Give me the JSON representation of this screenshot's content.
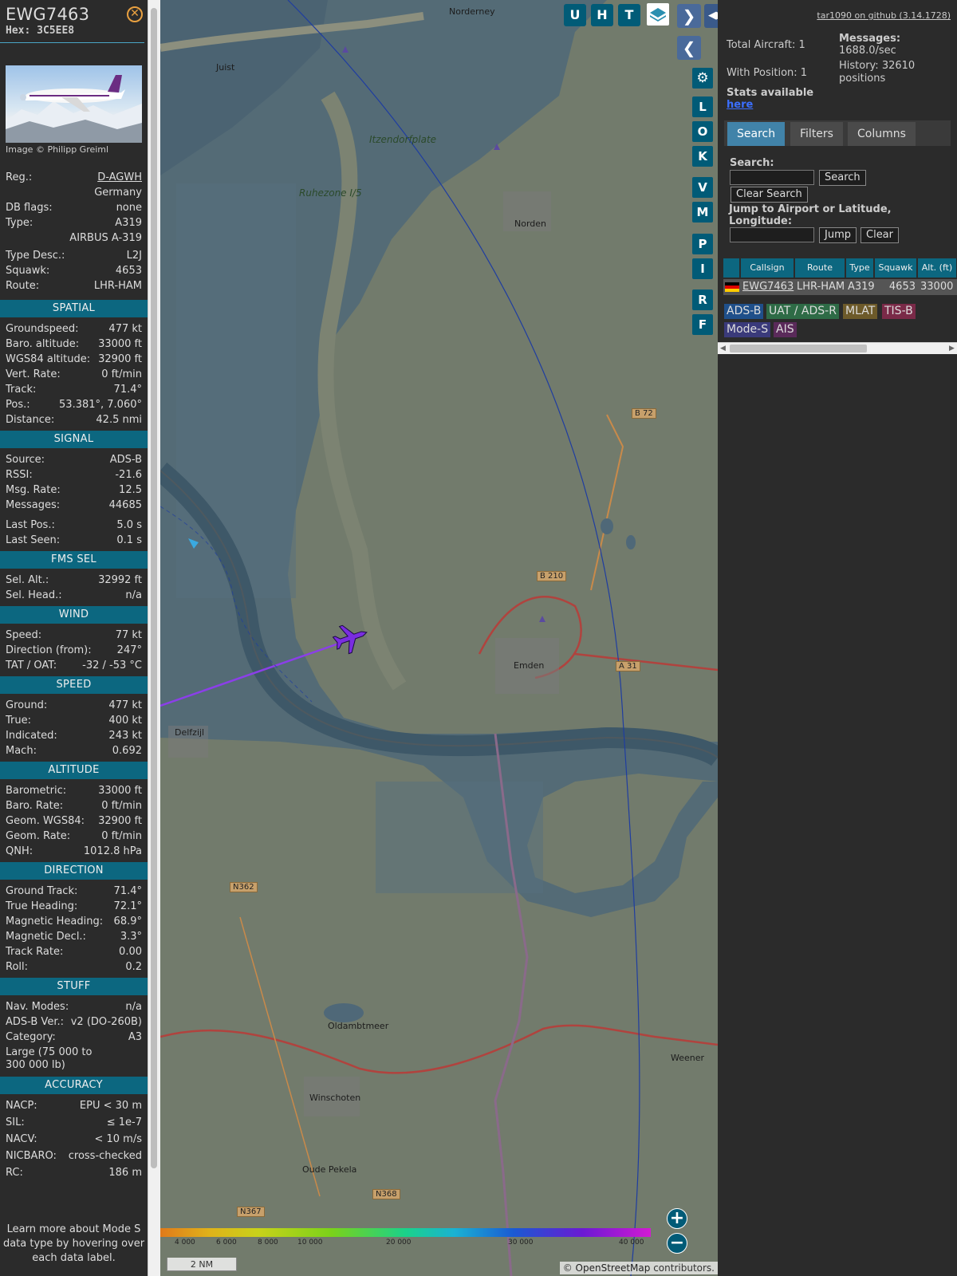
{
  "aircraft": {
    "callsign": "EWG7463",
    "hex": "Hex: 3C5EE8",
    "photo_credit": "Image © Philipp Greiml"
  },
  "info_rows": [
    {
      "k": "Reg.:",
      "v": "D-AGWH"
    },
    {
      "k": "",
      "v": "Germany"
    },
    {
      "k": "DB flags:",
      "v": "none"
    },
    {
      "k": "Type:",
      "v": "A319"
    },
    {
      "k": "",
      "v": "AIRBUS A-319"
    },
    {
      "k": "Type Desc.:",
      "v": "L2J"
    },
    {
      "k": "Squawk:",
      "v": "4653"
    },
    {
      "k": "Route:",
      "v": "LHR-HAM"
    }
  ],
  "sections": [
    {
      "title": "SPATIAL",
      "rows": [
        {
          "k": "Groundspeed:",
          "v": "477 kt"
        },
        {
          "k": "Baro. altitude:",
          "v": "33000 ft"
        },
        {
          "k": "WGS84 altitude:",
          "v": "32900 ft"
        },
        {
          "k": "Vert. Rate:",
          "v": "0 ft/min"
        },
        {
          "k": "Track:",
          "v": "71.4°"
        },
        {
          "k": "Pos.:",
          "v": "53.381°, 7.060°"
        },
        {
          "k": "Distance:",
          "v": "42.5 nmi"
        }
      ]
    },
    {
      "title": "SIGNAL",
      "rows": [
        {
          "k": "Source:",
          "v": "ADS-B"
        },
        {
          "k": "RSSI:",
          "v": "-21.6"
        },
        {
          "k": "Msg. Rate:",
          "v": "12.5"
        },
        {
          "k": "Messages:",
          "v": "44685"
        },
        {
          "k": "Last Pos.:",
          "v": "5.0 s"
        },
        {
          "k": "Last Seen:",
          "v": "0.1 s"
        }
      ]
    },
    {
      "title": "FMS SEL",
      "rows": [
        {
          "k": "Sel. Alt.:",
          "v": "32992 ft"
        },
        {
          "k": "Sel. Head.:",
          "v": "n/a"
        }
      ]
    },
    {
      "title": "WIND",
      "rows": [
        {
          "k": "Speed:",
          "v": "77 kt"
        },
        {
          "k": "Direction (from):",
          "v": "247°"
        },
        {
          "k": "TAT / OAT:",
          "v": "-32 / -53 °C"
        }
      ]
    },
    {
      "title": "SPEED",
      "rows": [
        {
          "k": "Ground:",
          "v": "477 kt"
        },
        {
          "k": "True:",
          "v": "400 kt"
        },
        {
          "k": "Indicated:",
          "v": "243 kt"
        },
        {
          "k": "Mach:",
          "v": "0.692"
        }
      ]
    },
    {
      "title": "ALTITUDE",
      "rows": [
        {
          "k": "Barometric:",
          "v": "33000 ft"
        },
        {
          "k": "Baro. Rate:",
          "v": "0 ft/min"
        },
        {
          "k": "Geom. WGS84:",
          "v": "32900 ft"
        },
        {
          "k": "Geom. Rate:",
          "v": "0 ft/min"
        },
        {
          "k": "QNH:",
          "v": "1012.8 hPa"
        }
      ]
    },
    {
      "title": "DIRECTION",
      "rows": [
        {
          "k": "Ground Track:",
          "v": "71.4°"
        },
        {
          "k": "True Heading:",
          "v": "72.1°"
        },
        {
          "k": "Magnetic Heading:",
          "v": "68.9°"
        },
        {
          "k": "Magnetic Decl.:",
          "v": "3.3°"
        },
        {
          "k": "Track Rate:",
          "v": "0.00"
        },
        {
          "k": "Roll:",
          "v": "0.2"
        }
      ]
    },
    {
      "title": "STUFF",
      "rows": [
        {
          "k": "Nav. Modes:",
          "v": "n/a"
        },
        {
          "k": "ADS-B Ver.:",
          "v": "v2 (DO-260B)"
        },
        {
          "k": "Category:",
          "v": "A3"
        },
        {
          "k": "Large (75 000 to 300 000 lb)",
          "v": ""
        }
      ]
    },
    {
      "title": "ACCURACY",
      "rows": [
        {
          "k": "NACP:",
          "v": "EPU < 30 m"
        },
        {
          "k": "SIL:",
          "v": "≤ 1e-7"
        },
        {
          "k": "NACV:",
          "v": "< 10 m/s"
        },
        {
          "k": "NICBARO:",
          "v": "cross-checked"
        },
        {
          "k": "RC:",
          "v": "186 m"
        }
      ]
    }
  ],
  "learn_more": "Learn more about Mode S data type by hovering over each data label.",
  "map": {
    "top_buttons": [
      "U",
      "H",
      "T"
    ],
    "side_buttons": [
      "L",
      "O",
      "K",
      "V",
      "M",
      "P",
      "I",
      "R",
      "F"
    ],
    "place_labels": [
      {
        "t": "Norderney"
      },
      {
        "t": "Juist"
      },
      {
        "t": "Norden"
      },
      {
        "t": "Emden"
      },
      {
        "t": "Delfzijl"
      },
      {
        "t": "Winschoten"
      },
      {
        "t": "Oude Pekela"
      },
      {
        "t": "Weener"
      },
      {
        "t": "Oldambtmeer"
      },
      {
        "t": "Ruhezone I/5"
      },
      {
        "t": "Itzendorfplate"
      }
    ],
    "road_labels": [
      "B 72",
      "B 210",
      "A 31",
      "N362",
      "N368",
      "N367"
    ],
    "color_scale_ticks": [
      "4 000",
      "6 000",
      "8 000",
      "10 000",
      "20 000",
      "30 000",
      "40 000"
    ],
    "scale": "2 NM",
    "attribution_prefix": "© ",
    "attribution_link": "OpenStreetMap",
    "attribution_suffix": " contributors."
  },
  "right": {
    "github": "tar1090 on github (3.14.1728)",
    "total_aircraft": "Total Aircraft: 1",
    "with_position": "With Position: 1",
    "messages_label": "Messages:",
    "messages_value": "1688.0/sec",
    "history_label": "History: 32610",
    "history_value": "positions",
    "stats_label": "Stats available",
    "stats_link": "here",
    "tabs": [
      "Search",
      "Filters",
      "Columns"
    ],
    "search_label": "Search:",
    "search_btn": "Search",
    "clear_search_btn": "Clear Search",
    "jump_label": "Jump to Airport or Latitude, Longitude:",
    "jump_btn": "Jump",
    "clear_btn": "Clear",
    "table": {
      "headers": [
        "Callsign",
        "Route",
        "Type",
        "Squawk",
        "Alt. (ft)"
      ],
      "row": [
        "EWG7463",
        "LHR-HAM",
        "A319",
        "4653",
        "33000"
      ]
    },
    "legend": [
      {
        "label": "ADS-B",
        "color": "#1f4f8a"
      },
      {
        "label": "UAT / ADS-R",
        "color": "#2e6b46"
      },
      {
        "label": "MLAT",
        "color": "#6d5a2a"
      },
      {
        "label": "TIS-B",
        "color": "#7a2a48"
      },
      {
        "label": "Mode-S",
        "color": "#3a3a7a"
      },
      {
        "label": "AIS",
        "color": "#5a2a5a"
      }
    ]
  }
}
